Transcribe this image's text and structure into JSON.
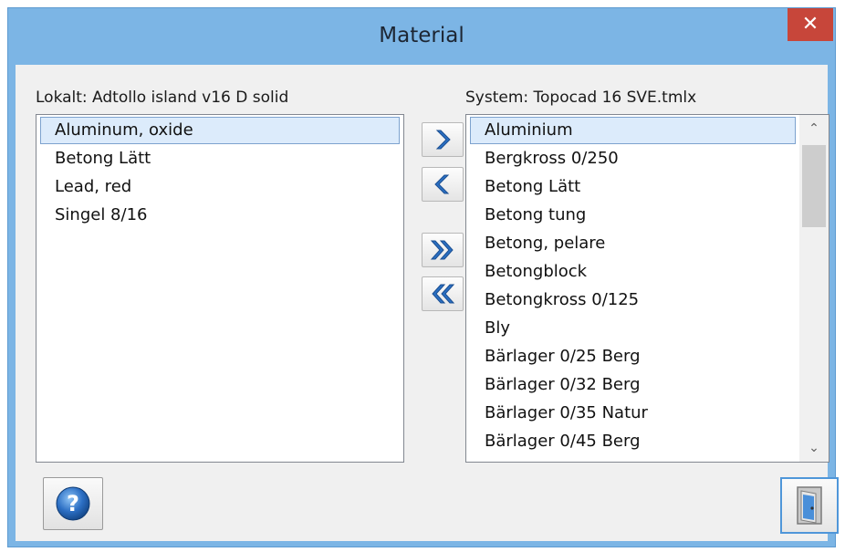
{
  "window": {
    "title": "Material",
    "close_glyph": "✕"
  },
  "local": {
    "label": "Lokalt: Adtollo island v16 D solid",
    "items": [
      "Aluminum, oxide",
      "Betong Lätt",
      "Lead, red",
      "Singel 8/16"
    ],
    "selected_index": 0
  },
  "system": {
    "label": "System: Topocad 16 SVE.tmlx",
    "items": [
      "Aluminium",
      "Bergkross 0/250",
      "Betong Lätt",
      "Betong tung",
      "Betong, pelare",
      "Betongblock",
      "Betongkross 0/125",
      "Bly",
      "Bärlager 0/25 Berg",
      "Bärlager 0/32 Berg",
      "Bärlager 0/35 Natur",
      "Bärlager 0/45 Berg"
    ],
    "selected_index": 0,
    "scroll_position_fraction": 0.0
  },
  "buttons": {
    "move_right": "chevron-right-icon",
    "move_left": "chevron-left-icon",
    "move_all_right": "double-chevron-right-icon",
    "move_all_left": "double-chevron-left-icon",
    "help": "question-icon",
    "exit": "door-icon"
  },
  "colors": {
    "title_bar": "#7cb5e5",
    "close_button": "#c7463a",
    "selection": "#dcebfb",
    "arrow_blue": "#2a6fc2"
  }
}
